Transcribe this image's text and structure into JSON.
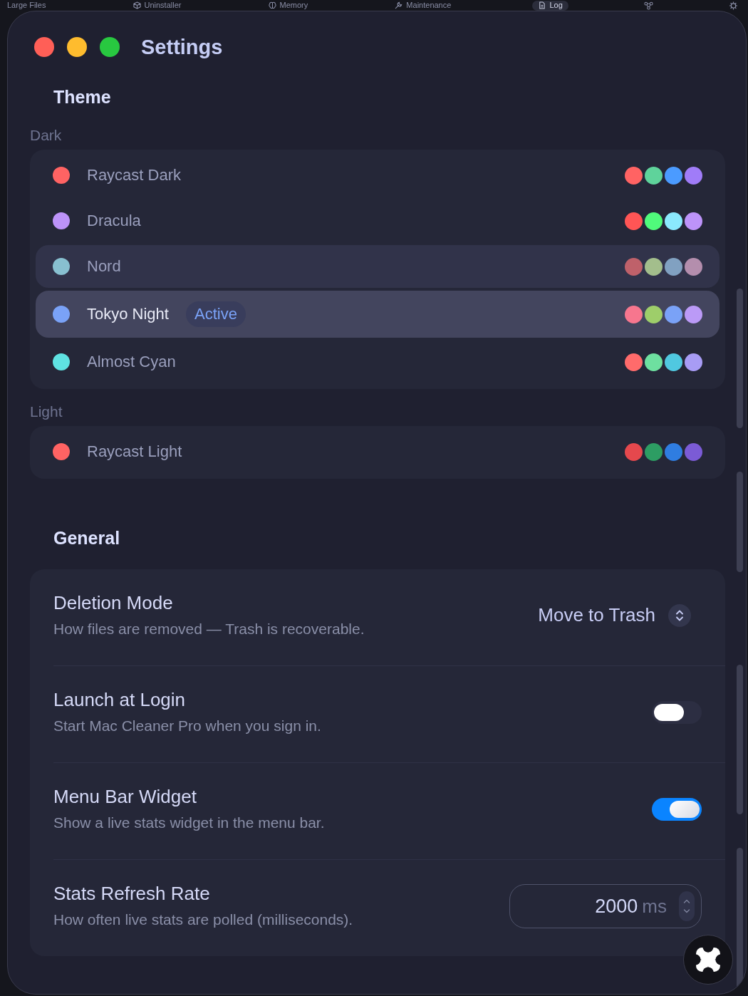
{
  "background_app": {
    "tabs": [
      {
        "label": "Large Files",
        "selected": false
      },
      {
        "label": "Uninstaller",
        "selected": false
      },
      {
        "label": "Memory",
        "selected": false
      },
      {
        "label": "Maintenance",
        "selected": false
      },
      {
        "label": "Log",
        "selected": true
      }
    ]
  },
  "window": {
    "title": "Settings"
  },
  "theme": {
    "heading": "Theme",
    "active_badge": "Active",
    "groups": [
      {
        "label": "Dark",
        "items": [
          {
            "name": "Raycast Dark",
            "color": "#ff6363",
            "palette": [
              {
                "color": "#ff6363"
              },
              {
                "color": "#5fd39b"
              },
              {
                "color": "#4b9bff"
              },
              {
                "color": "#a07cf8"
              }
            ],
            "selected": false,
            "hovered": false
          },
          {
            "name": "Dracula",
            "color": "#bd93f9",
            "palette": [
              {
                "color": "#ff5555"
              },
              {
                "color": "#50fa7b"
              },
              {
                "color": "#8be9fd"
              },
              {
                "color": "#bd93f9"
              }
            ],
            "selected": false,
            "hovered": false
          },
          {
            "name": "Nord",
            "color": "#88c0d0",
            "palette": [
              {
                "color": "#bf616a"
              },
              {
                "color": "#a3be8c"
              },
              {
                "color": "#81a1c1"
              },
              {
                "color": "#b48ead"
              }
            ],
            "selected": false,
            "hovered": true
          },
          {
            "name": "Tokyo Night",
            "color": "#7aa2f7",
            "palette": [
              {
                "color": "#f7768e"
              },
              {
                "color": "#9ece6a"
              },
              {
                "color": "#7aa2f7"
              },
              {
                "color": "#bb9af7"
              }
            ],
            "selected": true,
            "hovered": false
          },
          {
            "name": "Almost Cyan",
            "color": "#5fe2e2",
            "palette": [
              {
                "color": "#ff6b6b"
              },
              {
                "color": "#6ee0a0"
              },
              {
                "color": "#50c8e0"
              },
              {
                "color": "#a89cf5"
              }
            ],
            "selected": false,
            "hovered": false
          }
        ]
      },
      {
        "label": "Light",
        "items": [
          {
            "name": "Raycast Light",
            "color": "#ff6363",
            "palette": [
              {
                "color": "#e5484d"
              },
              {
                "color": "#2d9d63"
              },
              {
                "color": "#2f7de1"
              },
              {
                "color": "#7b5bd6"
              }
            ],
            "selected": false,
            "hovered": false
          }
        ]
      }
    ]
  },
  "general": {
    "heading": "General",
    "settings": [
      {
        "kind": "select",
        "title": "Deletion Mode",
        "description": "How files are removed — Trash is recoverable.",
        "value": "Move to Trash"
      },
      {
        "kind": "toggle",
        "title": "Launch at Login",
        "description": "Start Mac Cleaner Pro when you sign in.",
        "on": false
      },
      {
        "kind": "toggle",
        "title": "Menu Bar Widget",
        "description": "Show a live stats widget in the menu bar.",
        "on": true
      },
      {
        "kind": "number",
        "title": "Stats Refresh Rate",
        "description": "How often live stats are polled (milliseconds).",
        "value": "2000",
        "unit": "ms"
      }
    ]
  }
}
